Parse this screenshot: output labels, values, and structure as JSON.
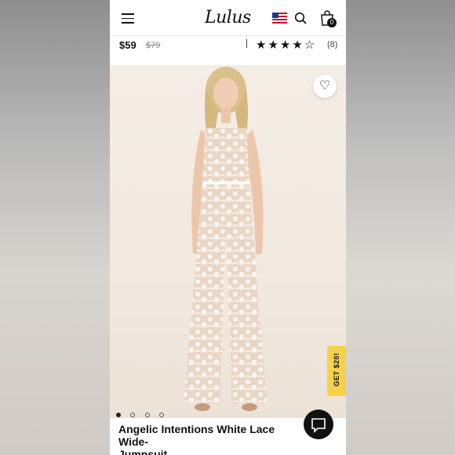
{
  "brand": {
    "logo_text": "Lulus"
  },
  "header": {
    "cart_count": "0",
    "icons": [
      "menu-icon",
      "us-flag-icon",
      "search-icon",
      "shopping-bag-icon"
    ]
  },
  "product": {
    "price_current": "$59",
    "price_original": "$79",
    "rating_stars": 4.5,
    "rating_display": "★★★★☆",
    "review_count": "(8)",
    "title": "Angelic Intentions White Lace Wide-Leg Jumpsuit",
    "title_visible": "Angelic Intentions White Lace Wide-\nJumpsuit"
  },
  "gallery": {
    "image_count": 5,
    "active_index": 0
  },
  "promo": {
    "label": "GET $20!"
  },
  "colors": {
    "accent_yellow": "#f6d24b",
    "text": "#111111",
    "muted": "#888888",
    "photo_bg": "#f1e9e0"
  }
}
